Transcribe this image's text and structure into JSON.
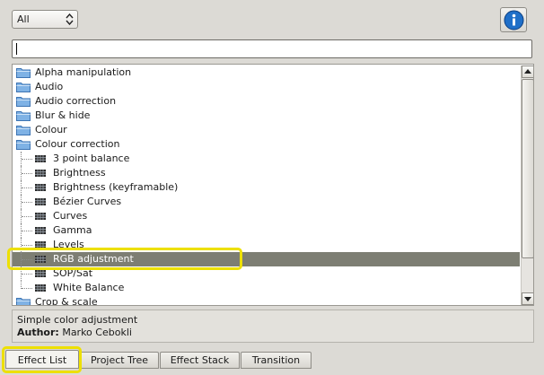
{
  "filter": {
    "selected": "All"
  },
  "search": {
    "value": ""
  },
  "tree": {
    "folders_before": [
      "Alpha manipulation",
      "Audio",
      "Audio correction",
      "Blur & hide",
      "Colour"
    ],
    "expanded_folder": "Colour correction",
    "children": [
      "3 point balance",
      "Brightness",
      "Brightness (keyframable)",
      "Bézier Curves",
      "Curves",
      "Gamma",
      "Levels",
      "RGB adjustment",
      "SOP/Sat",
      "White Balance"
    ],
    "selected": "RGB adjustment",
    "folders_after": [
      "Crop & scale"
    ]
  },
  "description": {
    "text": "Simple color adjustment",
    "author_label": "Author:",
    "author": "Marko Cebokli"
  },
  "tabs": [
    {
      "label": "Effect List",
      "active": true
    },
    {
      "label": "Project Tree",
      "active": false
    },
    {
      "label": "Effect Stack",
      "active": false
    },
    {
      "label": "Transition",
      "active": false
    }
  ],
  "icons": [
    "chevron-updown-icon",
    "info-icon",
    "folder-icon",
    "effect-icon",
    "scroll-up-icon",
    "scroll-down-icon"
  ],
  "colors": {
    "selection": "#7d7e73",
    "highlight": "#ede000",
    "info_blue": "#1f6fc8"
  }
}
